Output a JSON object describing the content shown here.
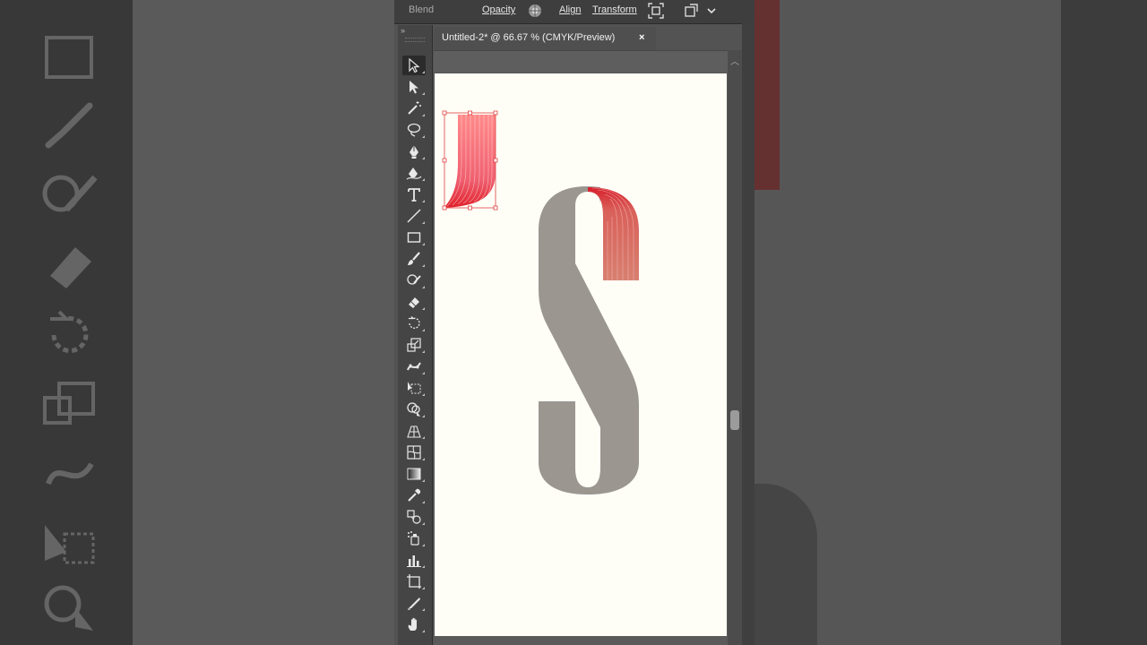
{
  "control_bar": {
    "blend_label": "Blend",
    "opacity_label": "Opacity",
    "align_label": "Align",
    "transform_label": "Transform"
  },
  "document": {
    "tab_title": "Untitled-2* @ 66.67 % (CMYK/Preview)",
    "close_glyph": "×"
  },
  "toolbar": {
    "collapse_glyph": "»",
    "active_tool": "selection-tool",
    "tools": [
      "selection-tool",
      "direct-selection-tool",
      "magic-wand-tool",
      "lasso-tool",
      "pen-tool",
      "curvature-tool",
      "type-tool",
      "line-segment-tool",
      "rectangle-tool",
      "paintbrush-tool",
      "shaper-tool",
      "eraser-tool",
      "rotate-tool",
      "scale-tool",
      "puppet-warp-tool",
      "free-transform-tool",
      "shape-builder-tool",
      "perspective-grid-tool",
      "mesh-tool",
      "gradient-tool",
      "eyedropper-tool",
      "blend-tool",
      "symbol-sprayer-tool",
      "column-graph-tool",
      "artboard-tool",
      "slice-tool",
      "hand-tool"
    ]
  },
  "artwork": {
    "letter_color": "#9b9690",
    "blend_red": "#e0202a",
    "selection_color": "#e04040",
    "artboard_color": "#fefef7"
  },
  "colors": {
    "ui_dark": "#3e3e3e",
    "ui_panel": "#535353",
    "text": "#e6e6e6"
  }
}
